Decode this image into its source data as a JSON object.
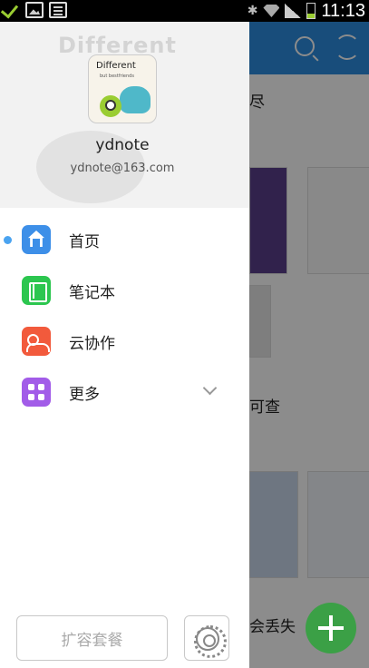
{
  "status_bar": {
    "time": "11:13",
    "icons": [
      "download-done-icon",
      "image-icon",
      "calculator-icon",
      "bluetooth-icon",
      "wifi-icon",
      "signal-icon",
      "battery-icon"
    ]
  },
  "drawer": {
    "header": {
      "background_text": "Different",
      "avatar_text_line1": "Different",
      "avatar_text_line2": "but bestfriends",
      "username": "ydnote",
      "email": "ydnote@163.com"
    },
    "menu": [
      {
        "label": "首页",
        "icon": "home-icon",
        "color": "#3d8fe8",
        "active": true
      },
      {
        "label": "笔记本",
        "icon": "notebook-icon",
        "color": "#2cc64f"
      },
      {
        "label": "云协作",
        "icon": "collaboration-icon",
        "color": "#f25a3c"
      },
      {
        "label": "更多",
        "icon": "more-grid-icon",
        "color": "#a25ce8",
        "expandable": true
      }
    ],
    "footer": {
      "upgrade_label": "扩容套餐",
      "settings_icon": "gear-icon"
    }
  },
  "background_app": {
    "text_1": "尽",
    "text_2": "可查",
    "text_3": "会丢失",
    "topbar_color": "#2d8ce0",
    "fab_color": "#3ba046"
  }
}
